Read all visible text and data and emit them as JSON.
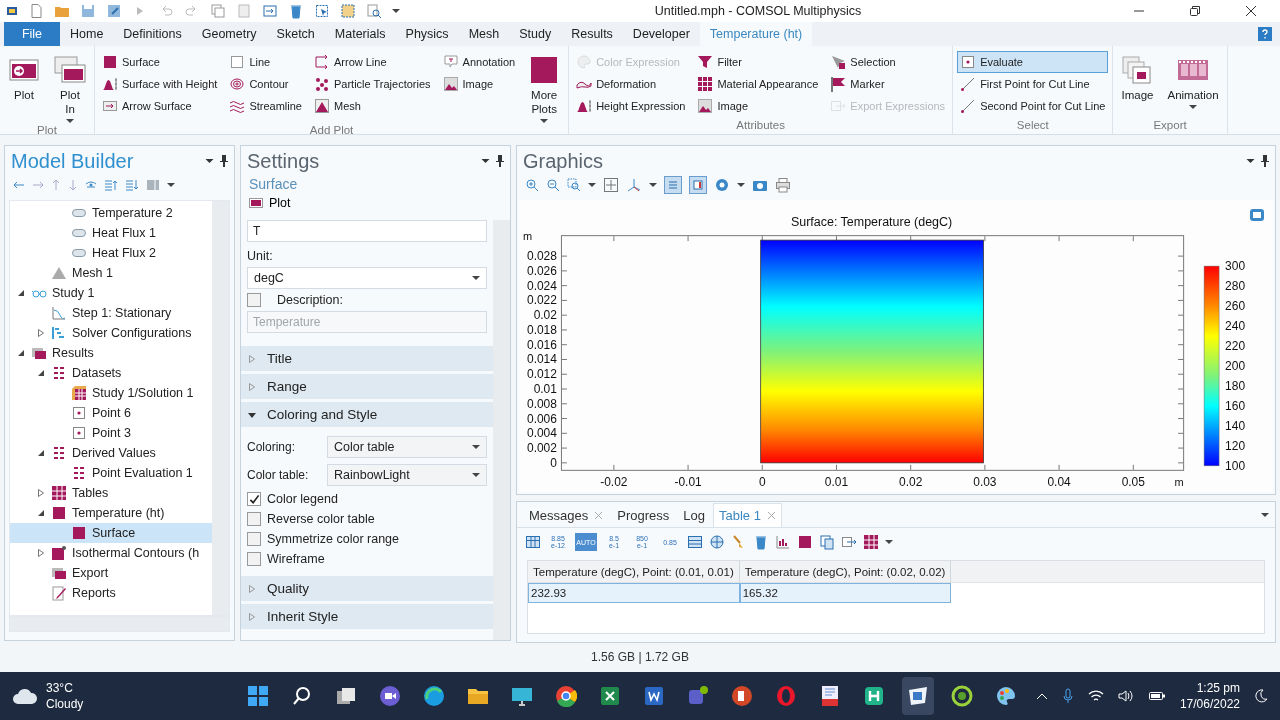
{
  "window": {
    "title": "Untitled.mph - COMSOL Multiphysics"
  },
  "menu_tabs": [
    {
      "label": "File",
      "kind": "file",
      "selected": false
    },
    {
      "label": "Home",
      "kind": "tab",
      "selected": false
    },
    {
      "label": "Definitions",
      "kind": "tab",
      "selected": false
    },
    {
      "label": "Geometry",
      "kind": "tab",
      "selected": false
    },
    {
      "label": "Sketch",
      "kind": "tab",
      "selected": false
    },
    {
      "label": "Materials",
      "kind": "tab",
      "selected": false
    },
    {
      "label": "Physics",
      "kind": "tab",
      "selected": false
    },
    {
      "label": "Mesh",
      "kind": "tab",
      "selected": false
    },
    {
      "label": "Study",
      "kind": "tab",
      "selected": false
    },
    {
      "label": "Results",
      "kind": "tab",
      "selected": false
    },
    {
      "label": "Developer",
      "kind": "tab",
      "selected": false
    },
    {
      "label": "Temperature (ht)",
      "kind": "tab",
      "selected": true
    }
  ],
  "ribbon": {
    "groups": [
      {
        "label": "Plot",
        "controls": [
          {
            "kind": "plot",
            "label": "Plot",
            "menu": false
          },
          {
            "kind": "plotin",
            "label": "Plot In",
            "menu": true
          }
        ]
      },
      {
        "label": "Add Plot",
        "controls": [
          {
            "items": [
              {
                "kind": "square",
                "label": "Surface",
                "disabled": false
              },
              {
                "kind": "peak",
                "label": "Surface with Height",
                "disabled": false
              },
              {
                "kind": "arrowbox",
                "label": "Arrow Surface",
                "disabled": false
              }
            ]
          },
          {
            "items": [
              {
                "kind": "outline",
                "label": "Line",
                "disabled": false
              },
              {
                "kind": "contour",
                "label": "Contour",
                "disabled": false
              },
              {
                "kind": "wave",
                "label": "Streamline",
                "disabled": false
              }
            ]
          },
          {
            "items": [
              {
                "kind": "arrowline",
                "label": "Arrow Line",
                "disabled": false
              },
              {
                "kind": "dots",
                "label": "Particle Trajectories",
                "disabled": false
              },
              {
                "kind": "meshtri",
                "label": "Mesh",
                "disabled": false
              }
            ]
          },
          {
            "items": [
              {
                "kind": "callout",
                "label": "Annotation",
                "disabled": false
              },
              {
                "kind": "image",
                "label": "Image",
                "disabled": false
              }
            ]
          },
          {
            "kind": "moreplots",
            "label": "More Plots",
            "menu": true
          }
        ]
      },
      {
        "label": "Attributes",
        "controls": [
          {
            "items": [
              {
                "kind": "palette",
                "label": "Color Expression",
                "disabled": true
              },
              {
                "kind": "bend",
                "label": "Deformation",
                "disabled": false
              },
              {
                "kind": "peak",
                "label": "Height Expression",
                "disabled": false
              }
            ]
          },
          {
            "items": [
              {
                "kind": "funnel",
                "label": "Filter",
                "disabled": false
              },
              {
                "kind": "grid",
                "label": "Material Appearance",
                "disabled": false
              },
              {
                "kind": "image",
                "label": "Image",
                "disabled": false
              }
            ]
          },
          {
            "items": [
              {
                "kind": "pointer",
                "label": "Selection",
                "disabled": false
              },
              {
                "kind": "flag",
                "label": "Marker",
                "disabled": false
              },
              {
                "kind": "exportarrow",
                "label": "Export Expressions",
                "disabled": true
              }
            ]
          }
        ]
      },
      {
        "label": "Select",
        "controls": [
          {
            "items": [
              {
                "kind": "point",
                "label": "Evaluate",
                "disabled": false,
                "selected": true
              },
              {
                "kind": "cutline",
                "label": "First Point for Cut Line",
                "disabled": false,
                "selected": false
              },
              {
                "kind": "cutline",
                "label": "Second Point for Cut Line",
                "disabled": false,
                "selected": false
              }
            ]
          }
        ]
      },
      {
        "label": "Export",
        "controls": [
          {
            "kind": "image",
            "label": "Image",
            "menu": false
          },
          {
            "kind": "animation",
            "label": "Animation",
            "menu": true
          }
        ]
      }
    ]
  },
  "model_builder": {
    "title": "Model Builder",
    "tree": [
      {
        "children": [
          {
            "children": [
              {
                "kind": "pill",
                "label": "Temperature 2",
                "selected": false
              },
              {
                "kind": "pill",
                "label": "Heat Flux 1",
                "selected": false
              },
              {
                "kind": "pill",
                "label": "Heat Flux 2",
                "selected": false
              }
            ]
          },
          {
            "kind": "mtri",
            "label": "Mesh 1",
            "selected": false
          }
        ]
      },
      {
        "kind": "study",
        "label": "Study 1",
        "selected": false,
        "expanded": true,
        "children": [
          {
            "kind": "step",
            "label": "Step 1: Stationary",
            "selected": false
          },
          {
            "kind": "solver",
            "label": "Solver Configurations",
            "selected": false,
            "expanded": false
          }
        ]
      },
      {
        "kind": "results",
        "label": "Results",
        "selected": false,
        "expanded": true,
        "children": [
          {
            "kind": "derived",
            "label": "Datasets",
            "selected": false,
            "expanded": true,
            "children": [
              {
                "kind": "cube",
                "label": "Study 1/Solution 1",
                "selected": false
              },
              {
                "kind": "point",
                "label": "Point 6",
                "selected": false
              },
              {
                "kind": "point",
                "label": "Point 3",
                "selected": false
              }
            ]
          },
          {
            "kind": "derived",
            "label": "Derived Values",
            "selected": false,
            "expanded": true,
            "children": [
              {
                "kind": "derived",
                "label": "Point Evaluation 1",
                "selected": false
              }
            ]
          },
          {
            "kind": "table",
            "label": "Tables",
            "selected": false,
            "expanded": false
          },
          {
            "kind": "square",
            "label": "Temperature (ht)",
            "selected": false,
            "expanded": true,
            "children": [
              {
                "kind": "square",
                "label": "Surface",
                "selected": true
              }
            ]
          },
          {
            "kind": "contours",
            "label": "Isothermal Contours (h",
            "selected": false,
            "expanded": false
          },
          {
            "kind": "results",
            "label": "Export",
            "selected": false
          },
          {
            "kind": "reports",
            "label": "Reports",
            "selected": false
          }
        ]
      }
    ]
  },
  "settings": {
    "title": "Settings",
    "node": "Surface",
    "plot_button": "Plot",
    "expression": {
      "value": "T"
    },
    "unit": {
      "label": "Unit:",
      "value": "degC"
    },
    "description": {
      "label": "Description:",
      "checked": false,
      "value": "Temperature"
    },
    "sections": [
      {
        "title": "Title",
        "expanded": false
      },
      {
        "title": "Range",
        "expanded": false
      },
      {
        "title": "Coloring and Style",
        "expanded": true,
        "fields": [
          {
            "kind": "select",
            "label": "Coloring:",
            "value": "Color table"
          },
          {
            "kind": "select",
            "label": "Color table:",
            "value": "RainbowLight"
          },
          {
            "kind": "checkbox",
            "label": "Color legend",
            "checked": true
          },
          {
            "kind": "checkbox",
            "label": "Reverse color table",
            "checked": false
          },
          {
            "kind": "checkbox",
            "label": "Symmetrize color range",
            "checked": false
          },
          {
            "kind": "checkbox",
            "label": "Wireframe",
            "checked": false
          }
        ]
      },
      {
        "title": "Quality",
        "expanded": false
      },
      {
        "title": "Inherit Style",
        "expanded": false
      }
    ]
  },
  "graphics": {
    "title": "Graphics",
    "plot": {
      "title": "Surface: Temperature (degC)",
      "y_unit": "m",
      "x_unit": "m",
      "y_ticks": [
        "0.028",
        "0.026",
        "0.024",
        "0.022",
        "0.02",
        "0.018",
        "0.016",
        "0.014",
        "0.012",
        "0.01",
        "0.008",
        "0.006",
        "0.004",
        "0.002",
        "0"
      ],
      "x_ticks": [
        "-0.02",
        "-0.01",
        "0",
        "0.01",
        "0.02",
        "0.03",
        "0.04",
        "0.05"
      ],
      "legend_ticks": [
        "300",
        "280",
        "260",
        "240",
        "220",
        "200",
        "180",
        "160",
        "140",
        "120",
        "100"
      ]
    }
  },
  "results": {
    "tabs": [
      {
        "label": "Messages",
        "closable": true,
        "selected": false
      },
      {
        "label": "Progress",
        "closable": false,
        "selected": false
      },
      {
        "label": "Log",
        "closable": false,
        "selected": false
      },
      {
        "label": "Table 1",
        "closable": true,
        "selected": true
      }
    ],
    "format_buttons": [
      {
        "label": "8.85 e-12",
        "selected": false
      },
      {
        "label": "AUTO",
        "selected": true
      },
      {
        "label": "8.5 e-1",
        "selected": false
      },
      {
        "label": "850 e-1",
        "selected": false
      },
      {
        "label": "0.85",
        "selected": false
      }
    ],
    "table": {
      "columns": [
        "Temperature (degC), Point: (0.01, 0.01)",
        "Temperature (degC), Point: (0.02, 0.02)"
      ],
      "rows": [
        [
          "232.93",
          "165.32"
        ]
      ]
    }
  },
  "status_bar": {
    "memory": "1.56 GB | 1.72 GB"
  },
  "taskbar": {
    "weather": {
      "temperature": "33°C",
      "condition": "Cloudy"
    },
    "clock": {
      "time": "1:25 pm",
      "date": "17/06/2022"
    }
  }
}
